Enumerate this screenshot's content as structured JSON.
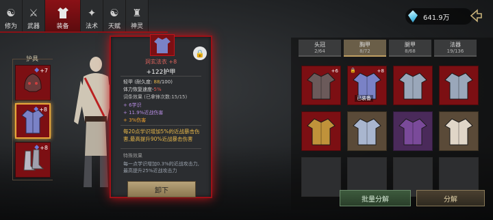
{
  "nav": {
    "tabs": [
      {
        "label": "修为",
        "icon": "meditation-icon"
      },
      {
        "label": "武器",
        "icon": "sword-icon"
      },
      {
        "label": "装备",
        "icon": "robe-icon"
      },
      {
        "label": "法术",
        "icon": "spell-icon"
      },
      {
        "label": "天赋",
        "icon": "yin-yang-icon"
      },
      {
        "label": "神灵",
        "icon": "deity-icon"
      }
    ],
    "active_index": 2
  },
  "currency": {
    "value": "641.9万",
    "icon": "crystal-icon"
  },
  "left_slots": {
    "label": "护具",
    "slots": [
      {
        "name": "helmet",
        "plus": "+7",
        "color": "#7c0f13"
      },
      {
        "name": "chest",
        "plus": "+8",
        "color": "#7c0f13"
      },
      {
        "name": "boots",
        "plus": "+8",
        "color": "#7c0f13"
      }
    ],
    "selected_index": 1
  },
  "tooltip": {
    "name": "洞玄法衣 +8",
    "armor": "+122护甲",
    "line1_prefix": "轻甲 (耐久度: ",
    "line1_value": "88",
    "line1_suffix": "/100)",
    "line2_prefix": "体力恢复速度-",
    "line2_value": "5%",
    "line3": "词条效果 (已拿锋次数:15/15)",
    "stat1": "+ 6学识",
    "stat2": "+ 11.9%近战伤害",
    "stat3": "+ 3%伤害",
    "bonus": "每20点学识增加5%的近战暴击伤害,最高提升90%近战暴击伤害",
    "special_title": "特殊效果",
    "special": "每一点学识增加0.3%的近战攻击力,最高提升25%近战攻击力",
    "unequip_label": "卸下"
  },
  "inventory": {
    "tabs": [
      {
        "label": "头冠",
        "count": "2/64"
      },
      {
        "label": "胸甲",
        "count": "8/72"
      },
      {
        "label": "腿甲",
        "count": "8/68"
      },
      {
        "label": "法器",
        "count": "19/136"
      }
    ],
    "active_tab": 1,
    "items": [
      {
        "bg": "red",
        "plus": "+6",
        "lock": false,
        "equipped": "",
        "color": "#6b5a5a"
      },
      {
        "bg": "red",
        "plus": "+8",
        "lock": true,
        "equipped": "已装备",
        "color": "#7a82c6"
      },
      {
        "bg": "red",
        "plus": "",
        "lock": false,
        "equipped": "",
        "color": "#9aa7ba"
      },
      {
        "bg": "red",
        "plus": "",
        "lock": false,
        "equipped": "",
        "color": "#9aa7ba"
      },
      {
        "bg": "red",
        "plus": "",
        "lock": false,
        "equipped": "",
        "color": "#c0923a"
      },
      {
        "bg": "brown",
        "plus": "",
        "lock": false,
        "equipped": "",
        "color": "#a9b6cf"
      },
      {
        "bg": "purple",
        "plus": "",
        "lock": false,
        "equipped": "",
        "color": "#7a4a9a"
      },
      {
        "bg": "brown",
        "plus": "",
        "lock": false,
        "equipped": "",
        "color": "#e0d6c8"
      },
      {
        "bg": "empty"
      },
      {
        "bg": "empty"
      },
      {
        "bg": "empty"
      },
      {
        "bg": "empty"
      }
    ],
    "batch_label": "批量分解",
    "decompose_label": "分解"
  }
}
